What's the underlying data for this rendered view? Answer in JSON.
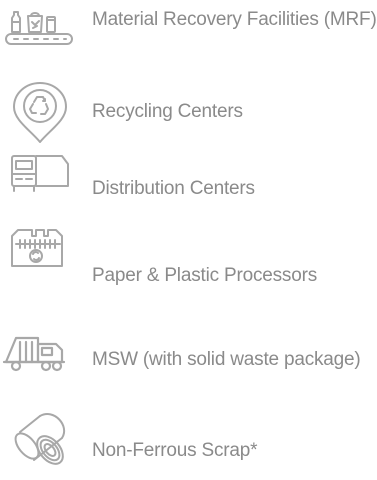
{
  "categories": [
    {
      "label": "Material Recovery Facilities (MRF)",
      "icon": "conveyor-belt-icon"
    },
    {
      "label": "Recycling Centers",
      "icon": "recycling-location-pin-icon"
    },
    {
      "label": "Distribution Centers",
      "icon": "delivery-truck-icon"
    },
    {
      "label": "Paper & Plastic Processors",
      "icon": "shredder-icon"
    },
    {
      "label": "MSW (with solid waste package)",
      "icon": "garbage-truck-icon"
    },
    {
      "label": "Non-Ferrous Scrap*",
      "icon": "metal-coil-icon"
    }
  ],
  "colors": {
    "text": "#8a8a8a",
    "icon": "#a8a8a8"
  }
}
